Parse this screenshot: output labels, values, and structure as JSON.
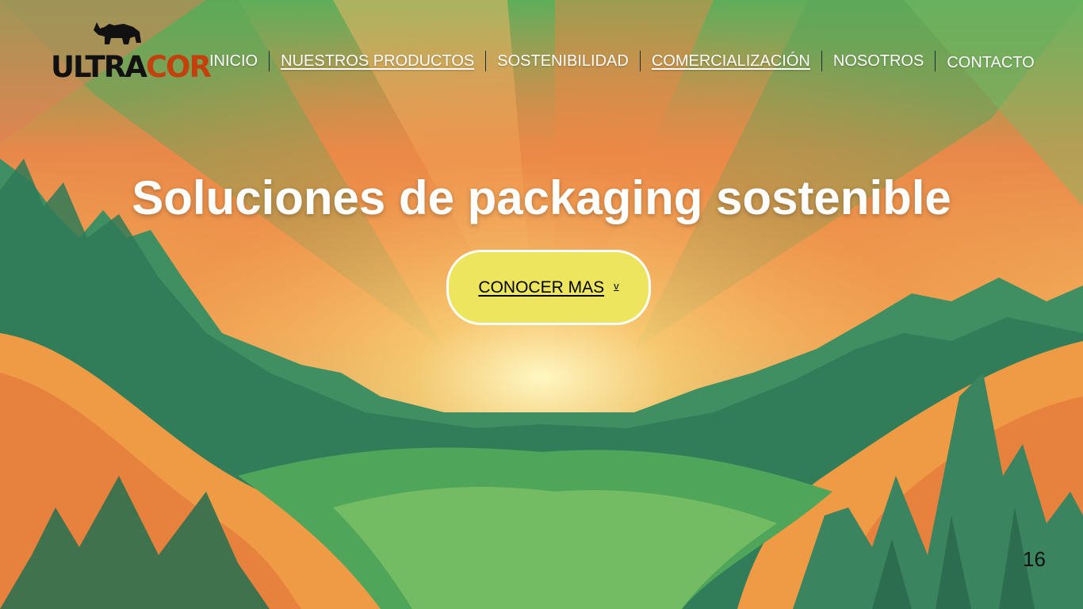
{
  "brand": {
    "part1": "ULTRA",
    "part2": "COR",
    "logo_icon": "rhino-icon",
    "colors": {
      "part1": "#111111",
      "part2": "#c2410c"
    }
  },
  "nav": {
    "items": [
      {
        "label": "INICIO"
      },
      {
        "label": "NUESTROS PRODUCTOS"
      },
      {
        "label": "SOSTENIBILIDAD"
      },
      {
        "label": "COMERCIALIZACIÓN"
      },
      {
        "label": "NOSOTROS"
      },
      {
        "label": "CONTACTO"
      }
    ]
  },
  "hero": {
    "title": "Soluciones de packaging sostenible",
    "cta_label": "CONOCER MAS",
    "cta_icon": "chevron-down-icon",
    "cta_color": "#ede55e"
  },
  "page_number": "16"
}
